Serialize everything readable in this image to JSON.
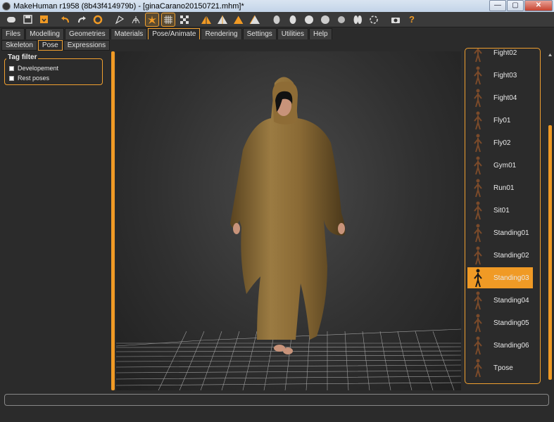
{
  "window": {
    "title": "MakeHuman r1958 (8b43f414979b) - [ginaCarano20150721.mhm]*",
    "minimize_label": "—",
    "restore_label": "▢",
    "close_label": "✕"
  },
  "toolbar": {
    "icons": [
      "toggle-view-icon",
      "save-icon",
      "export-icon",
      "undo-icon",
      "redo-icon",
      "reset-icon",
      "smooth-icon",
      "wireframe-icon",
      "pose-icon",
      "grid-icon",
      "checker-icon",
      "front-view-icon",
      "back-view-icon",
      "left-view-icon",
      "right-view-icon",
      "top-view-icon",
      "bottom-view-icon",
      "reset-camera-icon",
      "screenshot-icon",
      "help-icon"
    ],
    "active": [
      "pose-icon",
      "grid-icon"
    ],
    "help_glyph": "?"
  },
  "tabs": {
    "main": [
      "Files",
      "Modelling",
      "Geometries",
      "Materials",
      "Pose/Animate",
      "Rendering",
      "Settings",
      "Utilities",
      "Help"
    ],
    "main_active": "Pose/Animate",
    "sub": [
      "Skeleton",
      "Pose",
      "Expressions"
    ],
    "sub_active": "Pose"
  },
  "tag_filter": {
    "title": "Tag filter",
    "options": [
      {
        "label": "Developement",
        "checked": false
      },
      {
        "label": "Rest poses",
        "checked": false
      }
    ]
  },
  "poses": {
    "items": [
      "Fight02",
      "Fight03",
      "Fight04",
      "Fly01",
      "Fly02",
      "Gym01",
      "Run01",
      "Sit01",
      "Standing01",
      "Standing02",
      "Standing03",
      "Standing04",
      "Standing05",
      "Standing06",
      "Tpose"
    ],
    "selected": "Standing03"
  },
  "colors": {
    "accent": "#f09a25",
    "background": "#2b2b2b",
    "robe": "#8a6a35"
  }
}
